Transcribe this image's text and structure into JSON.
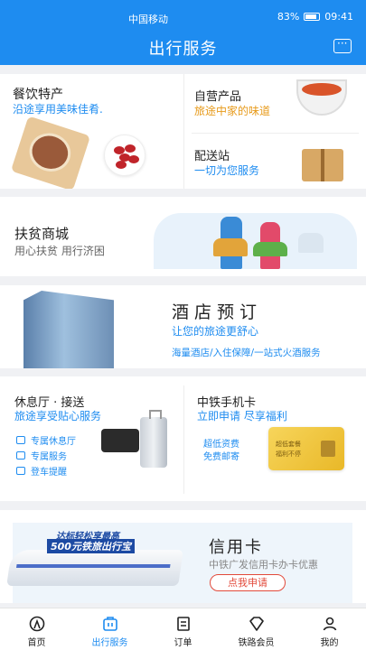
{
  "status_bar": {
    "carrier": "中国移动",
    "battery": "83%",
    "time": "09:41"
  },
  "header": {
    "title": "出行服务",
    "message_icon": "chat-bubble-icon"
  },
  "food": {
    "catering": {
      "title": "餐饮特产",
      "subtitle": "沿途享用美味佳肴."
    },
    "own_products": {
      "title": "自营产品",
      "subtitle": "旅途中家的味道"
    },
    "delivery": {
      "title": "配送站",
      "subtitle": "一切为您服务"
    }
  },
  "mall": {
    "title": "扶贫商城",
    "subtitle": "用心扶贫 用行济困"
  },
  "hotel": {
    "title": "酒店预订",
    "subtitle": "让您的旅途更舒心",
    "info": "海量酒店/入住保障/一站式火酒服务"
  },
  "lounge": {
    "title": "休息厅 · 接送",
    "subtitle": "旅途享受贴心服务",
    "items": [
      "专属休息厅",
      "专属服务",
      "登车提醒"
    ]
  },
  "sim": {
    "title": "中铁手机卡",
    "subtitle": "立即申请   尽享福利",
    "items": [
      "超低资费",
      "免费邮寄"
    ],
    "card_line1": "超低套餐",
    "card_line2": "福利不停"
  },
  "credit": {
    "promo_line1": "达标轻松享最高",
    "promo_line2": "500元铁旅出行宝",
    "title": "信用卡",
    "subtitle": "中铁广发信用卡办卡优惠",
    "button": "点我申请"
  },
  "tabbar": {
    "active": "出行服务",
    "items": [
      {
        "label": "首页",
        "icon": "home-icon"
      },
      {
        "label": "出行服务",
        "icon": "briefcase-icon"
      },
      {
        "label": "订单",
        "icon": "order-icon"
      },
      {
        "label": "铁路会员",
        "icon": "diamond-icon"
      },
      {
        "label": "我的",
        "icon": "person-icon"
      }
    ]
  },
  "colors": {
    "primary": "#1e8cf0",
    "accent_orange": "#e79a1a",
    "button_red": "#e24a3b"
  }
}
